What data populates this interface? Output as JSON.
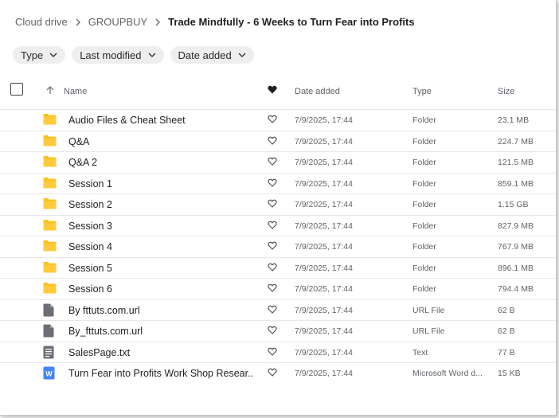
{
  "breadcrumb": {
    "items": [
      "Cloud drive",
      "GROUPBUY",
      "Trade Mindfully - 6 Weeks to Turn Fear into Profits"
    ]
  },
  "filters": [
    {
      "label": "Type"
    },
    {
      "label": "Last modified"
    },
    {
      "label": "Date added"
    }
  ],
  "columns": {
    "name": "Name",
    "date_added": "Date added",
    "type": "Type",
    "size": "Size"
  },
  "colors": {
    "folder": "#FFC01E",
    "file": "#6b6f75",
    "word": "#4285f4"
  },
  "files": [
    {
      "icon": "folder-icon",
      "name": "Audio Files & Cheat Sheet",
      "date": "7/9/2025, 17:44",
      "type": "Folder",
      "size": "23.1 MB"
    },
    {
      "icon": "folder-icon",
      "name": "Q&A",
      "date": "7/9/2025, 17:44",
      "type": "Folder",
      "size": "224.7 MB"
    },
    {
      "icon": "folder-icon",
      "name": "Q&A 2",
      "date": "7/9/2025, 17:44",
      "type": "Folder",
      "size": "121.5 MB"
    },
    {
      "icon": "folder-icon",
      "name": "Session 1",
      "date": "7/9/2025, 17:44",
      "type": "Folder",
      "size": "859.1 MB"
    },
    {
      "icon": "folder-icon",
      "name": "Session 2",
      "date": "7/9/2025, 17:44",
      "type": "Folder",
      "size": "1.15 GB"
    },
    {
      "icon": "folder-icon",
      "name": "Session 3",
      "date": "7/9/2025, 17:44",
      "type": "Folder",
      "size": "827.9 MB"
    },
    {
      "icon": "folder-icon",
      "name": "Session 4",
      "date": "7/9/2025, 17:44",
      "type": "Folder",
      "size": "767.9 MB"
    },
    {
      "icon": "folder-icon",
      "name": "Session 5",
      "date": "7/9/2025, 17:44",
      "type": "Folder",
      "size": "896.1 MB"
    },
    {
      "icon": "folder-icon",
      "name": "Session 6",
      "date": "7/9/2025, 17:44",
      "type": "Folder",
      "size": "794.4 MB"
    },
    {
      "icon": "generic-file-icon",
      "name": "By fttuts.com.url",
      "date": "7/9/2025, 17:44",
      "type": "URL File",
      "size": "62 B"
    },
    {
      "icon": "generic-file-icon",
      "name": "By_fttuts.com.url",
      "date": "7/9/2025, 17:44",
      "type": "URL File",
      "size": "62 B"
    },
    {
      "icon": "text-file-icon",
      "name": "SalesPage.txt",
      "date": "7/9/2025, 17:44",
      "type": "Text",
      "size": "77 B"
    },
    {
      "icon": "word-file-icon",
      "name": "Turn Fear into Profits Work Shop Resear...",
      "date": "7/9/2025, 17:44",
      "type": "Microsoft Word d...",
      "size": "15 KB"
    }
  ]
}
